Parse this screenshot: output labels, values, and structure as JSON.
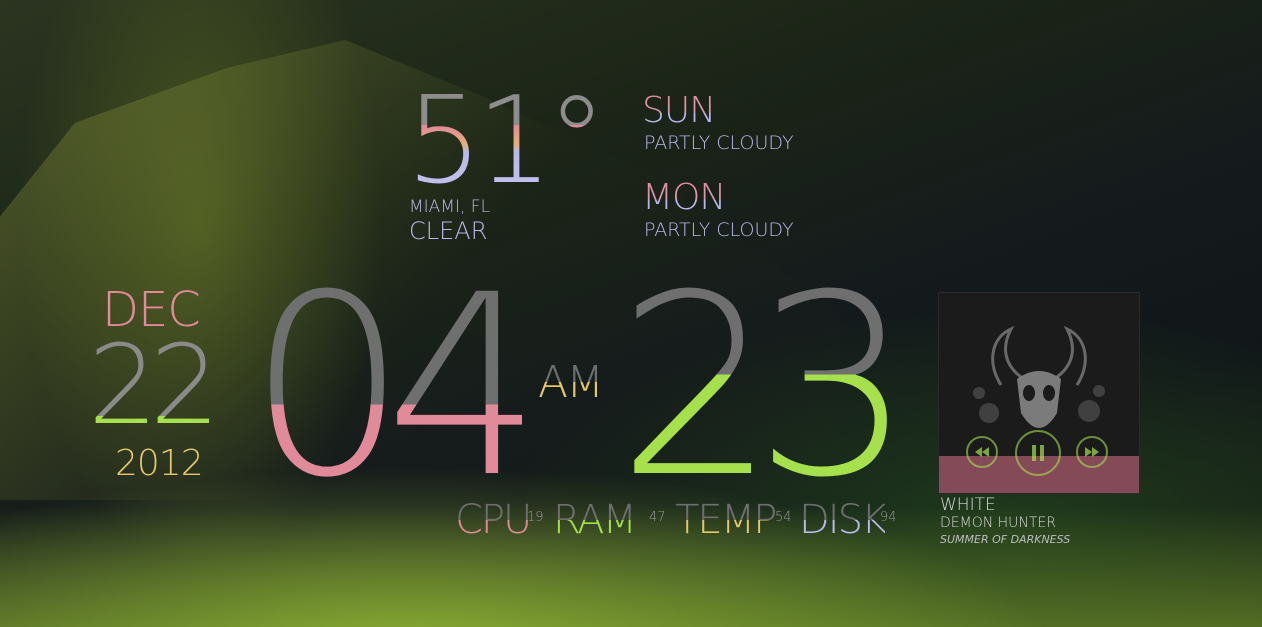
{
  "weather": {
    "temperature": "51°",
    "location": "MIAMI, FL",
    "condition": "CLEAR",
    "forecast": [
      {
        "day": "SUN",
        "condition": "PARTLY CLOUDY"
      },
      {
        "day": "MON",
        "condition": "PARTLY CLOUDY"
      }
    ]
  },
  "date": {
    "month": "DEC",
    "day": "22",
    "year": "2012"
  },
  "clock": {
    "hour": "04",
    "minute": "23",
    "meridiem": "AM"
  },
  "system": [
    {
      "label": "CPU",
      "value": "19"
    },
    {
      "label": "RAM",
      "value": "47"
    },
    {
      "label": "TEMP",
      "value": "54"
    },
    {
      "label": "DISK",
      "value": "94"
    }
  ],
  "music": {
    "title": "WHITE",
    "artist": "DEMON HUNTER",
    "album": "SUMMER OF DARKNESS",
    "controls": {
      "previous": "previous-icon",
      "play_pause": "play-pause-icon",
      "next": "next-icon"
    }
  },
  "colors": {
    "pink": "#e08a9a",
    "green": "#a6e04c",
    "yellow": "#e6c86a",
    "lavender": "#b9b8e8",
    "grey": "#8a8a8a"
  }
}
